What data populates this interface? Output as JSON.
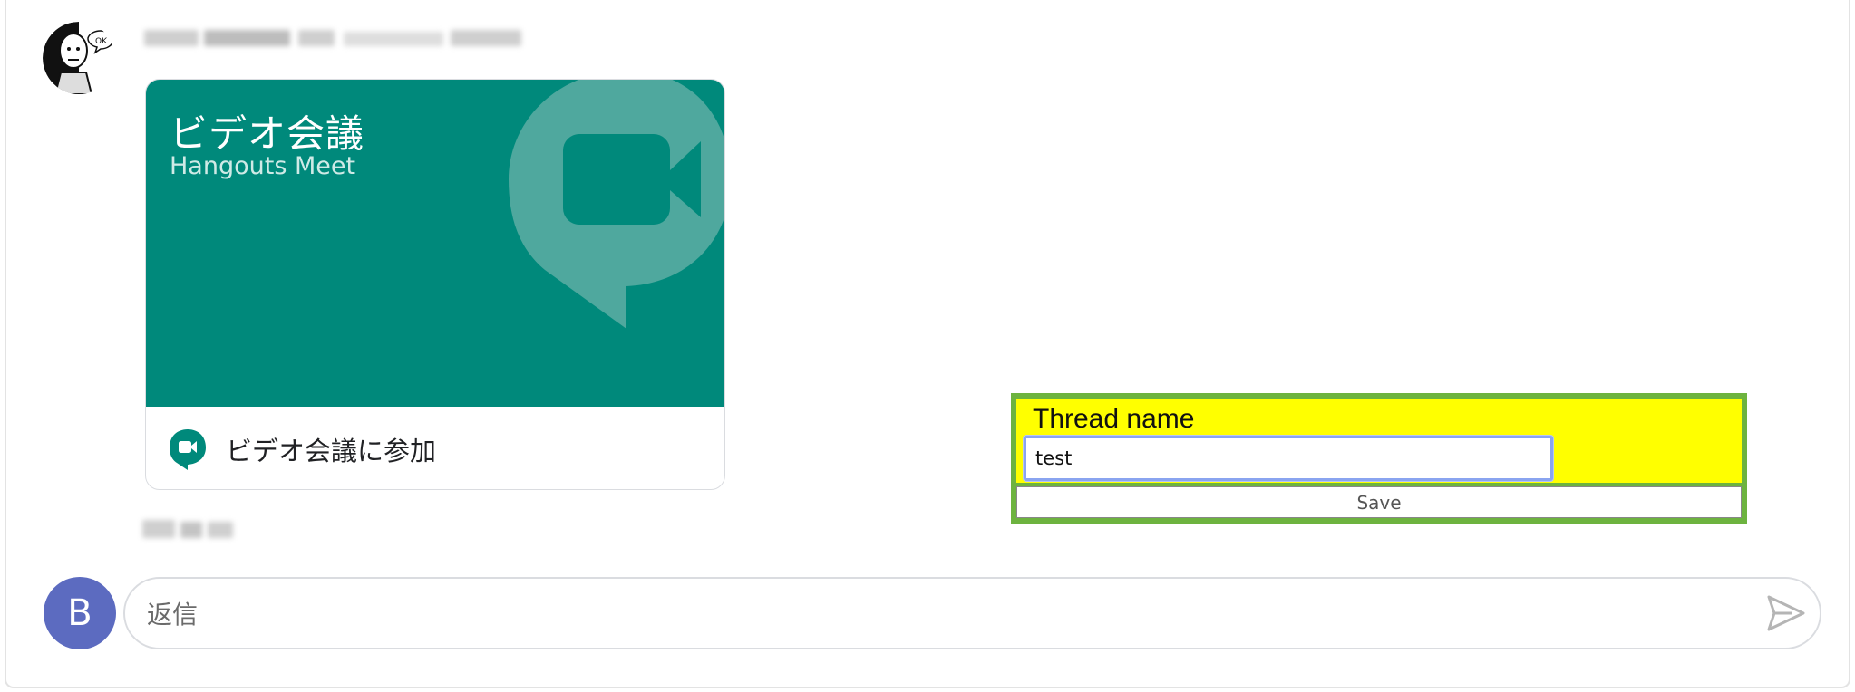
{
  "message": {
    "sender_avatar_icon": "person-avatar-icon",
    "sender_name_blurred": true,
    "timestamp_blurred": true
  },
  "meet_card": {
    "title": "ビデオ会議",
    "subtitle": "Hangouts Meet",
    "hero_icon": "meet-video-camera-icon",
    "hero_color": "#00897b",
    "action_label": "ビデオ会議に参加",
    "action_icon": "meet-logo-icon"
  },
  "thread_form": {
    "label": "Thread name",
    "input_value": "test",
    "save_label": "Save",
    "highlight_color": "#ffff00",
    "border_color": "#6db33f"
  },
  "reply": {
    "avatar_letter": "B",
    "avatar_color": "#5c6bc0",
    "placeholder": "返信",
    "send_icon": "send-icon"
  }
}
